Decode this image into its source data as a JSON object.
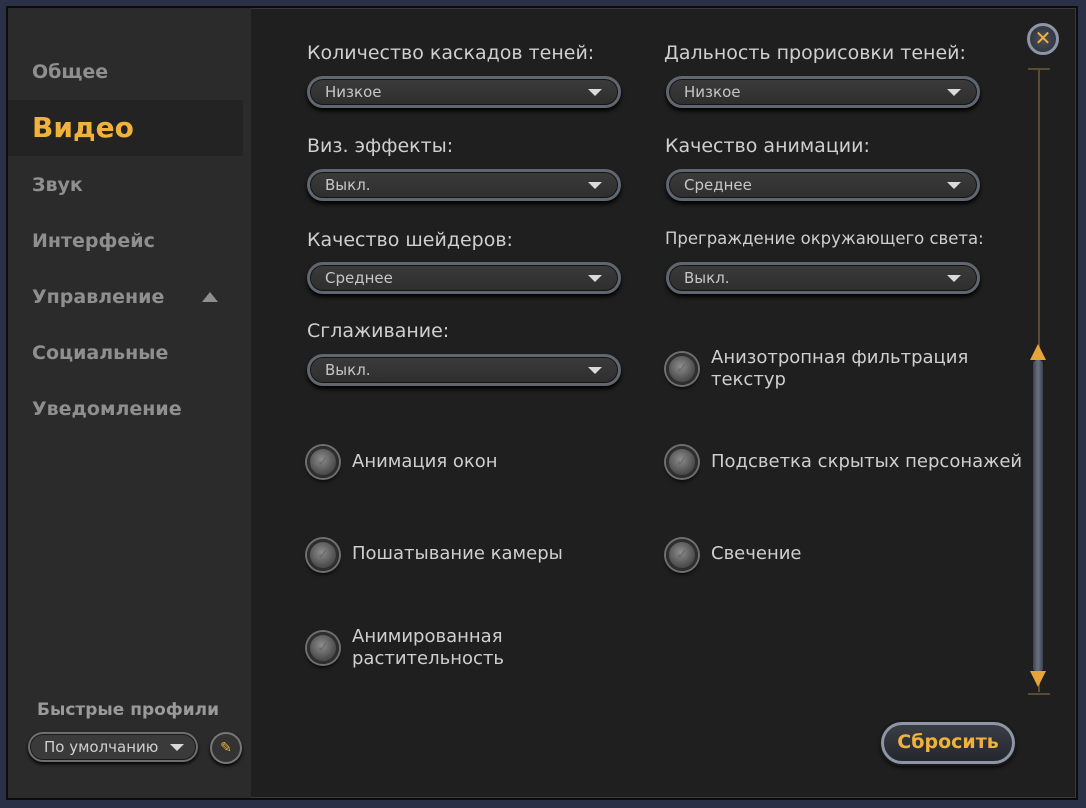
{
  "nav": {
    "items": [
      {
        "label": "Общее"
      },
      {
        "label": "Видео"
      },
      {
        "label": "Звук"
      },
      {
        "label": "Интерфейс"
      },
      {
        "label": "Управление"
      },
      {
        "label": "Социальные"
      },
      {
        "label": "Уведомление"
      }
    ],
    "active": "Видео"
  },
  "quick_profiles": {
    "label": "Быстрые профили",
    "selected": "По умолчанию"
  },
  "settings": {
    "shadow_cascades": {
      "label": "Количество каскадов теней:",
      "value": "Низкое"
    },
    "shadow_distance": {
      "label": "Дальность прорисовки теней:",
      "value": "Низкое"
    },
    "visual_effects": {
      "label": "Виз. эффекты:",
      "value": "Выкл."
    },
    "animation_quality": {
      "label": "Качество анимации:",
      "value": "Среднее"
    },
    "shader_quality": {
      "label": "Качество шейдеров:",
      "value": "Среднее"
    },
    "ambient_occlusion": {
      "label": "Преграждение окружающего света:",
      "value": "Выкл."
    },
    "antialiasing": {
      "label": "Сглаживание:",
      "value": "Выкл."
    }
  },
  "toggles": {
    "anisotropic": {
      "label_line1": "Анизотропная фильтрация",
      "label_line2": "текстур"
    },
    "window_animation": {
      "label": "Анимация окон"
    },
    "hidden_chars": {
      "label": "Подсветка скрытых персонажей"
    },
    "camera_shake": {
      "label": "Пошатывание камеры"
    },
    "glow": {
      "label": "Свечение"
    },
    "animated_foliage": {
      "label_line1": "Анимированная",
      "label_line2": "растительность"
    }
  },
  "buttons": {
    "reset": "Сбросить",
    "close_icon": "close-icon"
  },
  "colors": {
    "accent": "#f0b23a",
    "panel": "#1f1f1f",
    "sidebar": "#2b2b2b"
  }
}
